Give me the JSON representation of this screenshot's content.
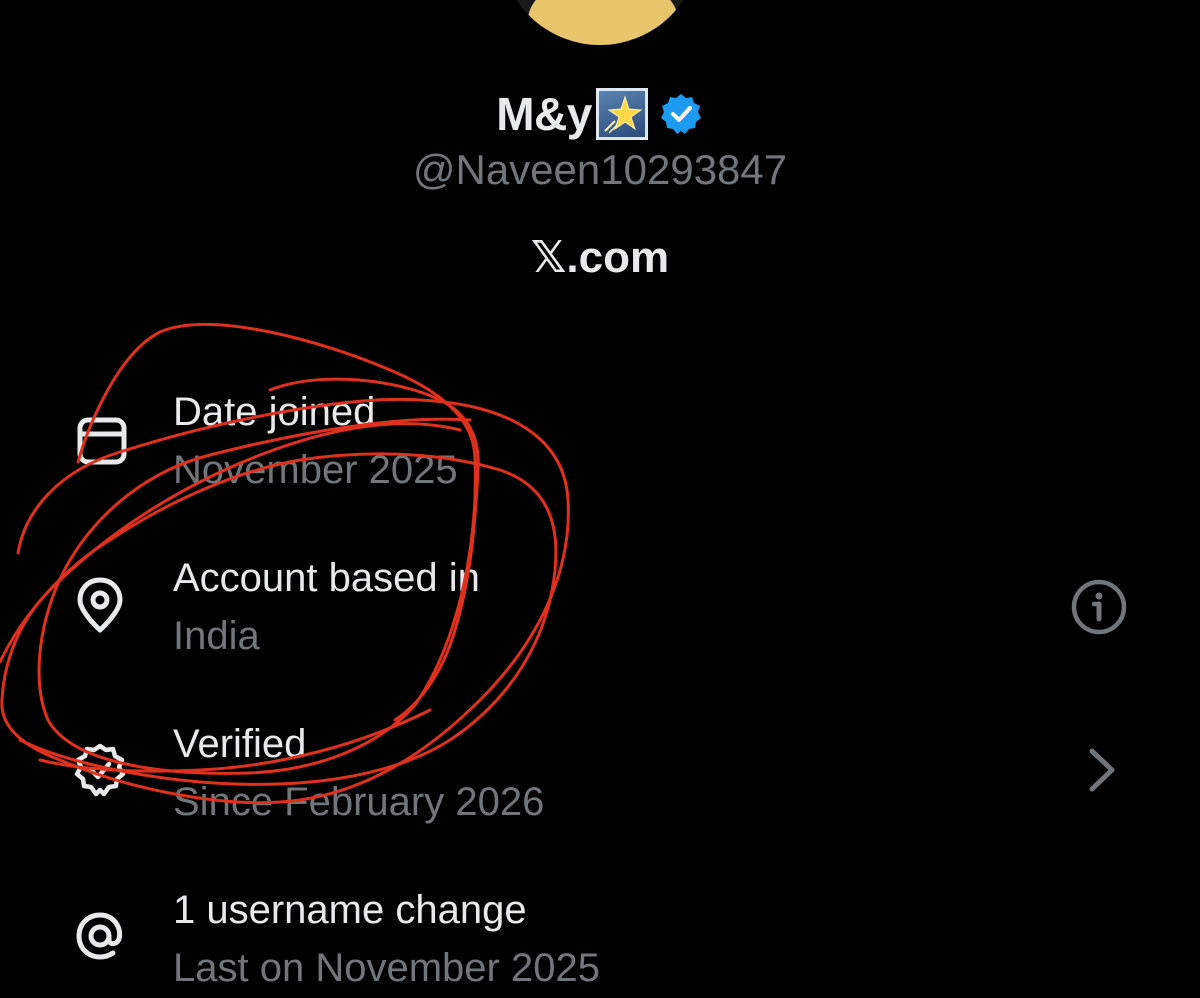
{
  "profile": {
    "display_name": "M&y",
    "name_emoji": "glowing-star-emoji",
    "handle": "@Naveen10293847",
    "site": "𝕏.com"
  },
  "details": [
    {
      "icon": "calendar-icon",
      "title": "Date joined",
      "value": "November 2025"
    },
    {
      "icon": "location-pin-icon",
      "title": "Account based in",
      "value": "India"
    },
    {
      "icon": "verified-badge-icon",
      "title": "Verified",
      "value": "Since February 2026"
    },
    {
      "icon": "at-sign-icon",
      "title": "1 username change",
      "value": "Last on November 2025"
    }
  ],
  "colors": {
    "background": "#000000",
    "primary_text": "#e7e9ea",
    "secondary_text": "#71767b",
    "verified_blue": "#1d9bf0",
    "annotation_red": "#e0301e"
  }
}
